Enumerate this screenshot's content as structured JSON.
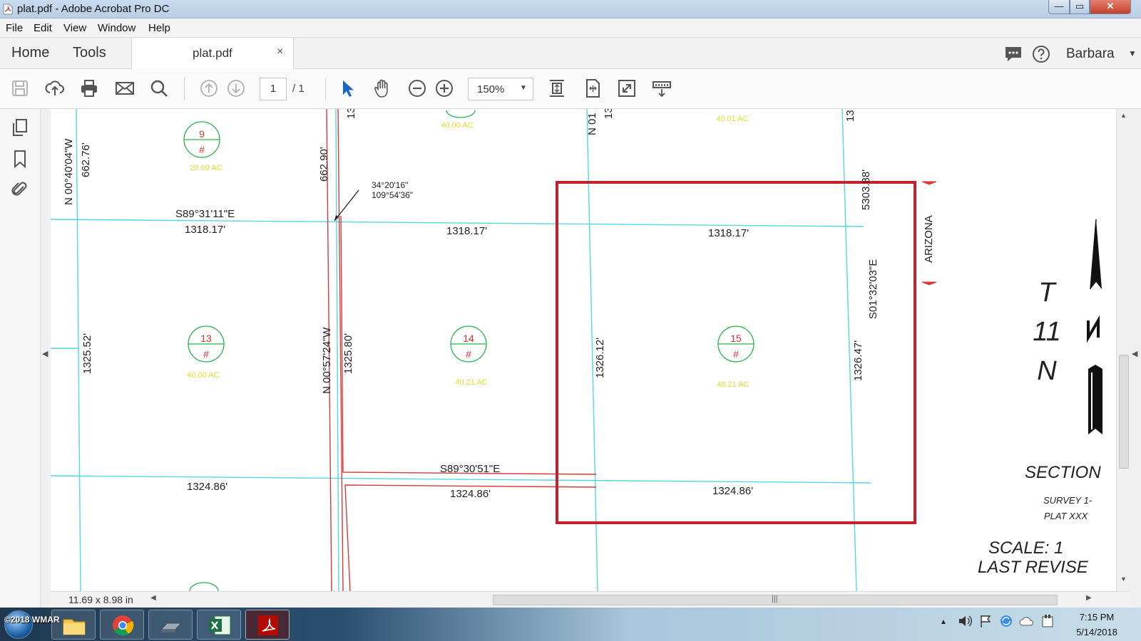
{
  "window": {
    "title": "plat.pdf - Adobe Acrobat Pro DC",
    "min": "—",
    "max": "▭",
    "close": "✕"
  },
  "menu": [
    "File",
    "Edit",
    "View",
    "Window",
    "Help"
  ],
  "tabs": {
    "home": "Home",
    "tools": "Tools",
    "document": "plat.pdf",
    "close": "×"
  },
  "user": {
    "name": "Barbara"
  },
  "toolbar": {
    "page_current": "1",
    "page_total": "/ 1",
    "zoom": "150%",
    "icons": [
      "save-icon",
      "upload-icon",
      "print-icon",
      "email-icon",
      "search-icon",
      "prev-page-icon",
      "next-page-icon",
      "select-arrow-icon",
      "hand-icon",
      "zoom-out-icon",
      "zoom-in-icon",
      "fit-page-icon",
      "fit-width-icon",
      "full-screen-icon",
      "read-mode-icon"
    ]
  },
  "plat": {
    "lots": [
      {
        "number": "9",
        "symbol": "#",
        "acres": "20.00 AC"
      },
      {
        "number": "13",
        "symbol": "#",
        "acres": "40.00 AC"
      },
      {
        "number": "14",
        "symbol": "#",
        "acres": "40.21 AC"
      },
      {
        "number": "15",
        "symbol": "#",
        "acres": "40.21 AC"
      }
    ],
    "top_acres": [
      "40.00 AC",
      "40.01 AC"
    ],
    "labels": {
      "bearing_left": "N 00°40'04\"W",
      "dist_662_76": "662.76'",
      "dist_662_90": "662.90'",
      "bearing_s89_31": "S89°31'11\"E",
      "dist_1318_a": "1318.17'",
      "dist_1318_b": "1318.17'",
      "dist_1318_c": "1318.17'",
      "coord_lat": "34°20'16\"",
      "coord_lon": "109°54'36\"",
      "dist_5303": "5303.88'",
      "arizona": "ARIZONA",
      "bearing_s01": "S01°32'03\"E",
      "dist_1325_52": "1325.52'",
      "bearing_n00_57": "N 00°57'24\"W",
      "dist_1325_80": "1325.80'",
      "dist_1326_12": "1326.12'",
      "dist_1326_47": "1326.47'",
      "bearing_s89_30": "S89°30'51\"E",
      "dist_1324_a": "1324.86'",
      "dist_1324_b": "1324.86'",
      "dist_1324_c": "1324.86'",
      "partial_13a": "13",
      "partial_n01": "N 01",
      "partial_13b": "13",
      "partial_13c": "13",
      "township_t": "T",
      "township_11": "11",
      "township_n": "N",
      "section": "SECTION",
      "survey": "SURVEY  1-",
      "plat": "PLAT   XXX",
      "scale": "SCALE:    1",
      "last_revised": "LAST  REVISE"
    }
  },
  "status": {
    "page_size": "11.69 x 8.98 in"
  },
  "taskbar": {
    "watermark": "©2018 WMAR",
    "apps": [
      "file-explorer-icon",
      "chrome-icon",
      "scanner-icon",
      "excel-icon",
      "acrobat-icon"
    ],
    "time": "7:15 PM",
    "date": "5/14/2018"
  },
  "colors": {
    "highlight_red": "#c8202a",
    "plat_cyan": "#53d7e4",
    "plat_red": "#d63a3a",
    "lot_green": "#2bb24c",
    "acre_yellow": "#e2dc2a"
  }
}
